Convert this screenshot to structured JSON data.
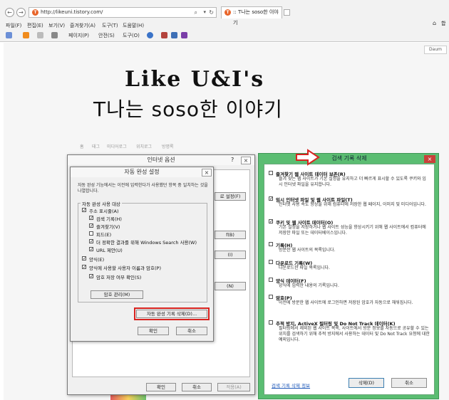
{
  "browser": {
    "address": "http://likeuni.tistory.com/",
    "favicon_letter": "T",
    "tab_title": ":: T나는 soso한 이야기",
    "menus": [
      "파일(F)",
      "편집(E)",
      "보기(V)",
      "즐겨찾기(A)",
      "도구(T)",
      "도움말(H)"
    ],
    "toolbar": [
      "페이지(P)",
      "안전(S)",
      "도구(O)"
    ],
    "right_stub": "합",
    "daum": "Daum"
  },
  "blog": {
    "logo_line1": "Like U&I's",
    "logo_line2": "T나는 soso한 이야기",
    "nav": [
      "홈",
      "태그",
      "미디어로그",
      "위치로그",
      "방명록"
    ]
  },
  "internet_options": {
    "title": "인터넷 옵션",
    "help": "?",
    "close": "×",
    "bg_buttons": [
      "로 설정(F)",
      "f(B)",
      "(I)",
      "(N)"
    ],
    "ok": "확인",
    "cancel": "취소",
    "apply": "적용(A)"
  },
  "autocomplete": {
    "title": "자동 완성 설정",
    "close": "×",
    "intro": "자동 완성 기능에서는 이전에 입력한다가 사용했던 항목 중 일치하는 것을 나열합니다.",
    "group_label": "자동 완성 사용 대상",
    "items": [
      {
        "label": "주소 표시줄(A)",
        "checked": true,
        "indent": 0
      },
      {
        "label": "검색 기록(H)",
        "checked": true,
        "indent": 1
      },
      {
        "label": "즐겨찾기(V)",
        "checked": true,
        "indent": 1
      },
      {
        "label": "피드(E)",
        "checked": false,
        "indent": 1
      },
      {
        "label": "더 정확한 결과를 위해 Windows Search 사용(W)",
        "checked": true,
        "indent": 1
      },
      {
        "label": "URL 제안(U)",
        "checked": true,
        "indent": 1
      },
      {
        "label": "양식(E)",
        "checked": true,
        "indent": 0
      },
      {
        "label": "양식에 사용할 사용자 이름과 암호(P)",
        "checked": true,
        "indent": 0
      },
      {
        "label": "암호 저장 여부 확인(S)",
        "checked": true,
        "indent": 1
      }
    ],
    "manage_passwords": "암호 관리(M)",
    "delete_history": "자동 완성 기록 삭제(D)...",
    "ok": "확인",
    "cancel": "취소"
  },
  "delete_history": {
    "title": "검색 기록 삭제",
    "close": "×",
    "items": [
      {
        "label": "즐겨찾기 웹 사이트 데이터 보존(R)",
        "checked": false,
        "desc": "즐겨 찾는 웹 사이트가 기본 설정을 유지하고 더 빠르게 표시할 수 있도록 쿠키와 임시 인터넷 파일을 유지합니다."
      },
      {
        "label": "임시 인터넷 파일 및 웹 사이트 파일(T)",
        "checked": true,
        "desc": "인터넷 사용 속도 향상을 위해 컴퓨터에 저장한 웹 페이지, 이미지 및 미디어입니다."
      },
      {
        "label": "쿠키 및 웹 사이트 데이터(O)",
        "checked": true,
        "desc": "기본 설정을 저장하거나 웹 사이트 성능을 향상시키기 위해 웹 사이트에서 컴퓨터에 저장한 파일 또는 데이터베이스입니다."
      },
      {
        "label": "기록(H)",
        "checked": false,
        "desc": "방문한 웹 사이트의 목록입니다."
      },
      {
        "label": "다운로드 기록(W)",
        "checked": false,
        "desc": "다운로드한 파일 목록입니다."
      },
      {
        "label": "양식 데이터(F)",
        "checked": false,
        "desc": "양식에 입력한 내용의 기록입니다."
      },
      {
        "label": "암호(P)",
        "checked": false,
        "desc": "이전에 방문한 웹 사이트에 로그인하면 저장된 암호가 자동으로 채워집니다."
      },
      {
        "label": "추적 방지, ActiveX 필터링 및 Do Not Track 데이터(K)",
        "checked": false,
        "desc": "필터링에서 제외된 웹 사이트 목록, 사이트에서 방문 정보를 자동으로 공유할 수 있는 위치를 검색하기 위해 추적 방지에서 사용하는 데이터 및 Do Not Track 요청에 대한 예외입니다."
      }
    ],
    "info_link": "검색 기록 삭제 정보",
    "delete": "삭제(D)",
    "cancel": "취소"
  }
}
